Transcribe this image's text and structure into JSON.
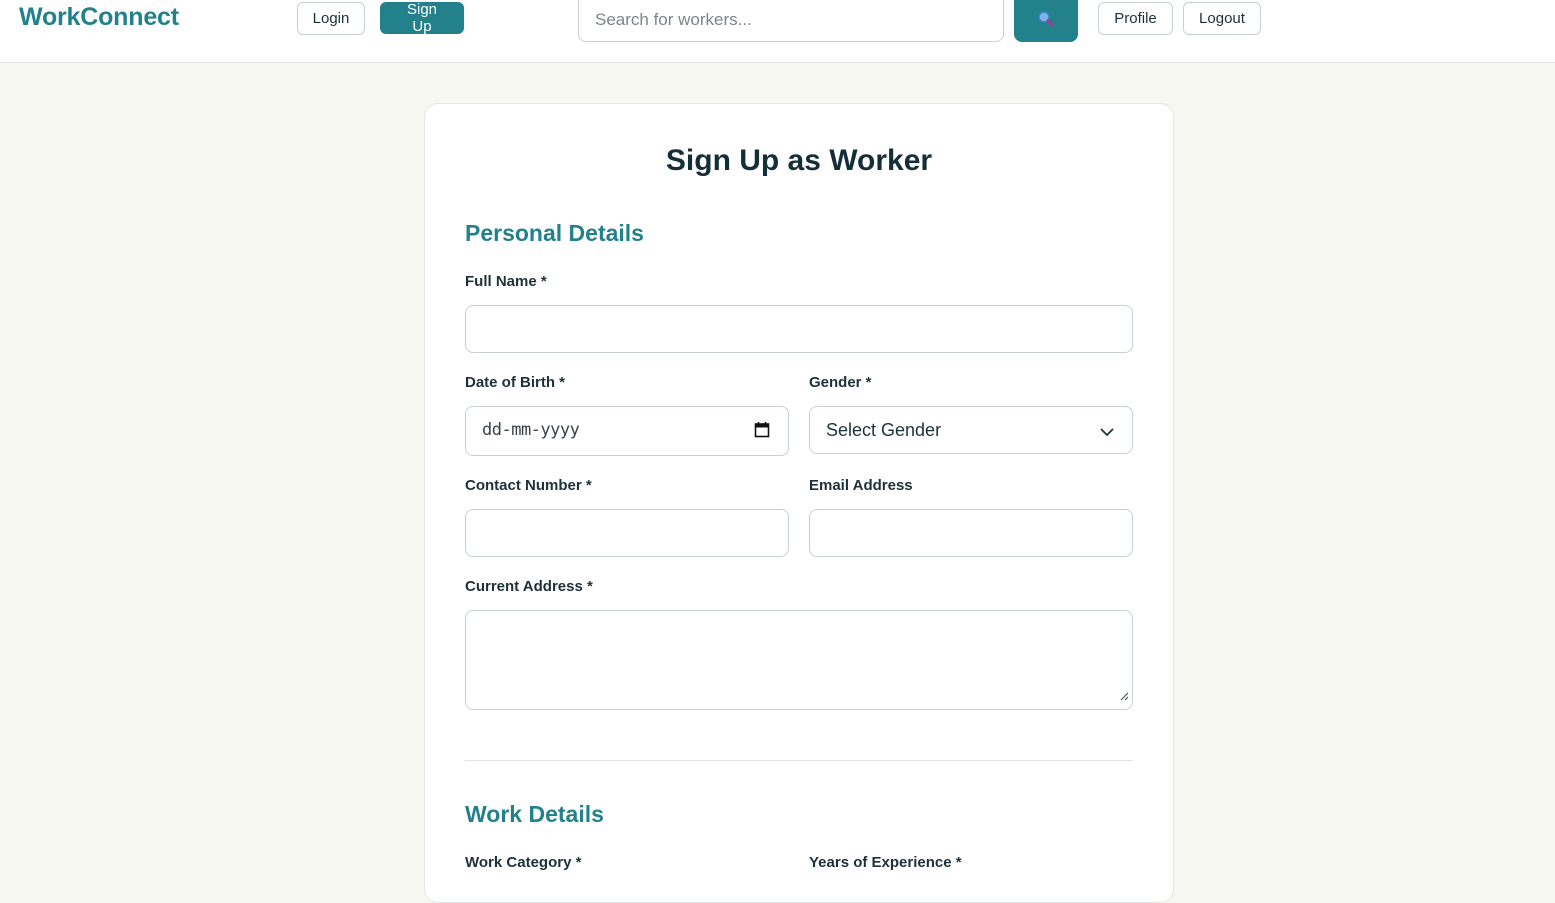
{
  "header": {
    "brand": "WorkConnect",
    "login_label": "Login",
    "signup_label": "Sign Up",
    "search_placeholder": "Search for workers...",
    "search_icon": "magnifier-icon",
    "profile_label": "Profile",
    "logout_label": "Logout"
  },
  "form": {
    "title": "Sign Up as Worker",
    "personal_section": "Personal Details",
    "full_name_label": "Full Name *",
    "full_name_value": "",
    "dob_label": "Date of Birth *",
    "dob_placeholder": "dd-mm-yyyy",
    "dob_icon": "calendar-icon",
    "gender_label": "Gender *",
    "gender_selected": "Select Gender",
    "contact_label": "Contact Number *",
    "contact_value": "",
    "email_label": "Email Address",
    "email_value": "",
    "address_label": "Current Address *",
    "address_value": "",
    "work_section": "Work Details",
    "work_category_label": "Work Category *",
    "experience_label": "Years of Experience *"
  },
  "colors": {
    "accent": "#23818c",
    "page_background": "#f7f7f2",
    "heading": "#152f38"
  }
}
